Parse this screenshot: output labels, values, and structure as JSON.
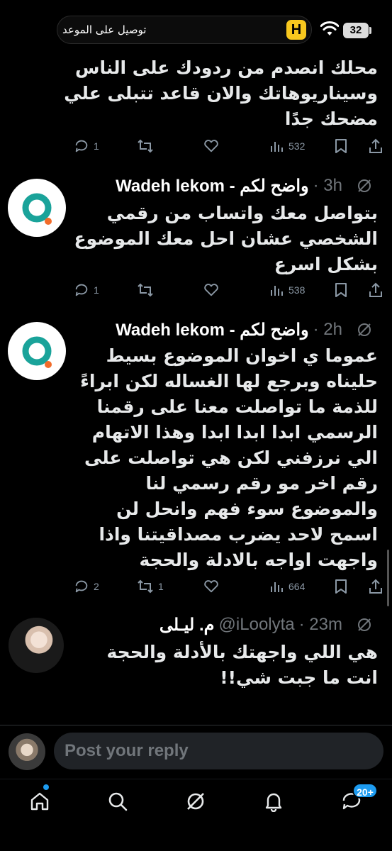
{
  "status_bar": {
    "pill_text": "توصيل على الموعد",
    "pill_badge": "H",
    "battery": "32"
  },
  "tweets": [
    {
      "text": "محلك انصدم من ردودك على الناس\nوسيناريوهاتك والان قاعد تتبلى علي\nمضحك جدًا",
      "replies": "1",
      "reposts": "",
      "views": "532"
    },
    {
      "name": "Wadeh lekom - واضح لكم",
      "meta": "· 3h",
      "text": "بتواصل معك واتساب من رقمي\nالشخصي عشان احل معك الموضوع\nبشكل اسرع",
      "replies": "1",
      "reposts": "",
      "views": "538"
    },
    {
      "name": "Wadeh lekom - واضح لكم",
      "meta": "· 2h",
      "text": "عموما ي اخوان الموضوع بسيط\nحليناه وبرجع لها الغساله لكن ابراءً\nللذمة ما تواصلت معنا على رقمنا\nالرسمي ابدا ابدا ابدا وهذا الاتهام\nالي نرزفني لكن هي تواصلت على\nرقم اخر مو رقم رسمي لنا\nوالموضوع سوء فهم وانحل لن\nاسمح لاحد يضرب مصداقيتنا واذا\nواجهت اواجه بالادلة والحجة",
      "replies": "2",
      "reposts": "1",
      "views": "664"
    },
    {
      "name": "م. ليـلى",
      "handle": "@iLoolyta",
      "meta": "· 23m",
      "text": "هي اللي واجهتك بالأدلة والحجة\nانت ما جبت شي!!"
    }
  ],
  "reply_bar": {
    "placeholder": "Post your reply"
  },
  "bottom_nav": {
    "items": [
      "home-icon",
      "search-icon",
      "grok-icon",
      "notifications-icon",
      "messages-icon"
    ],
    "messages_badge": "20+"
  },
  "colors": {
    "background": "#000000",
    "text": "#e7e9ea",
    "muted": "#71767b",
    "accent": "#1d9bf0"
  }
}
